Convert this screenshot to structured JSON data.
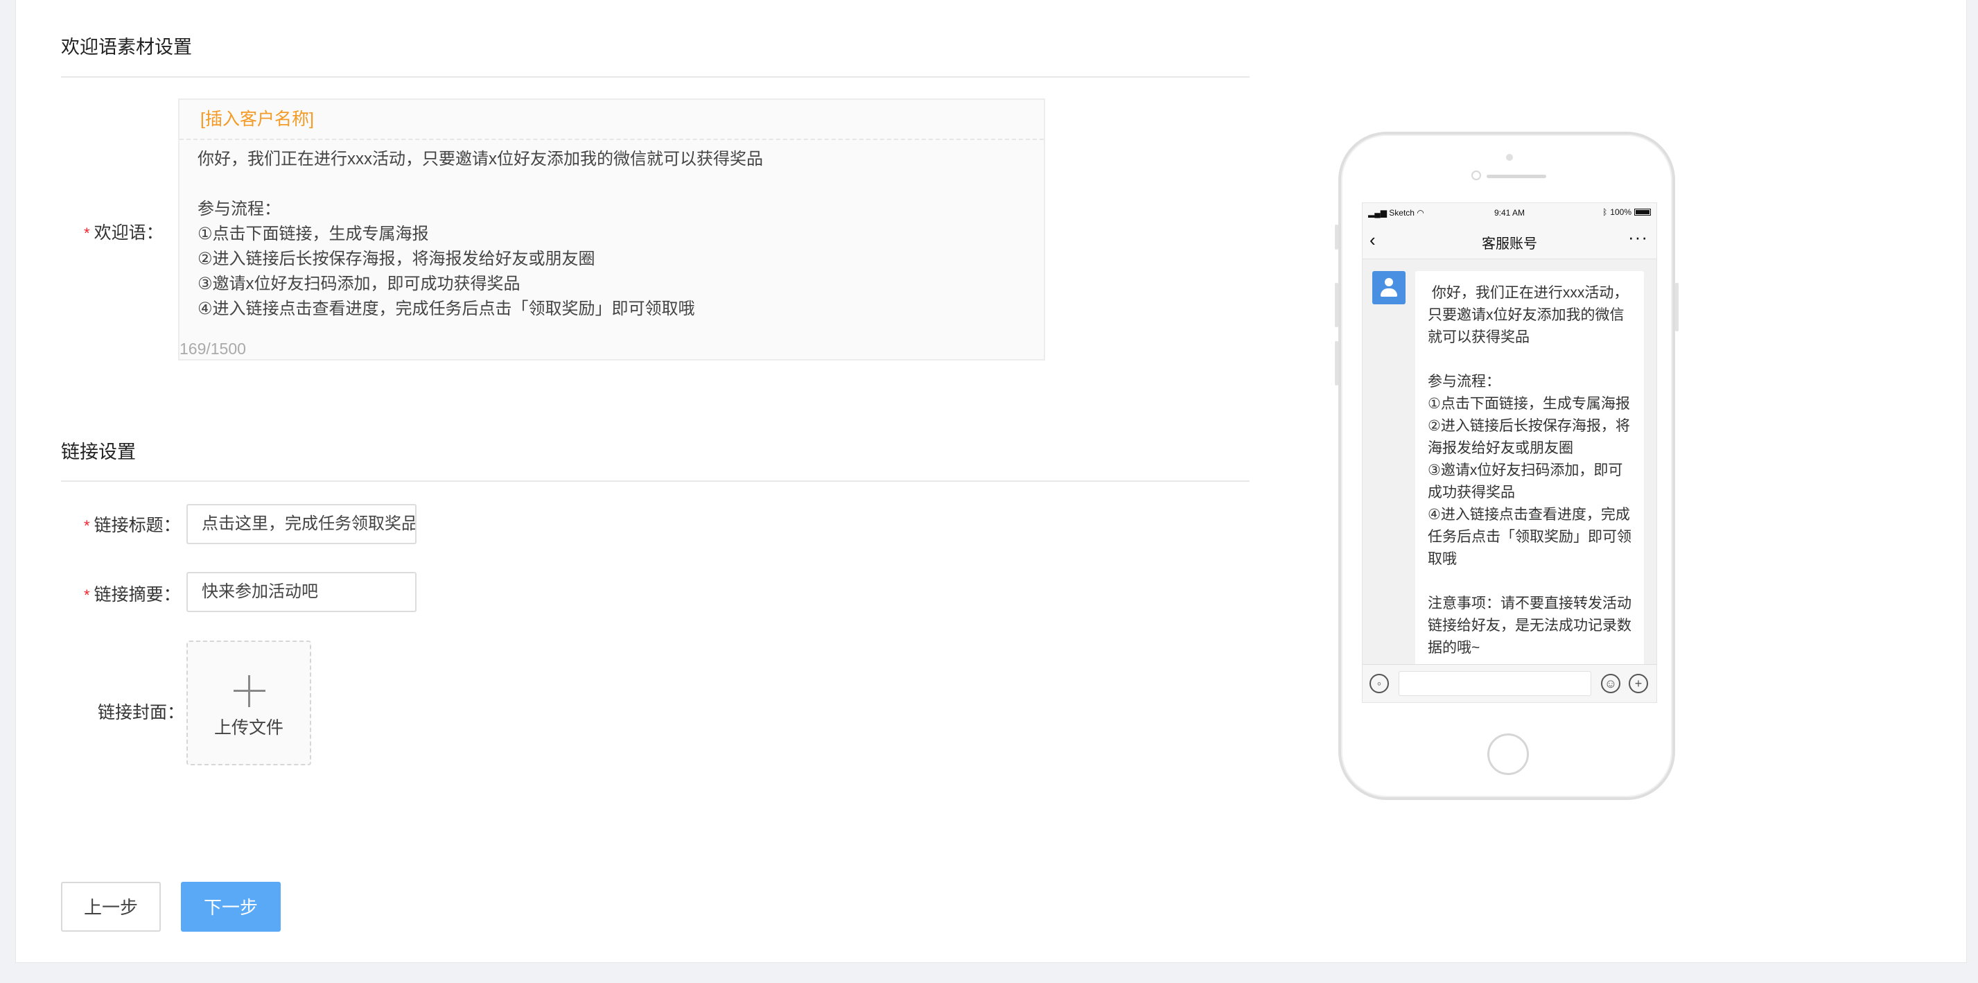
{
  "welcome_section": {
    "title": "欢迎语素材设置",
    "label": "欢迎语：",
    "insert_customer_name": "[插入客户名称]",
    "text": "你好，我们正在进行xxx活动，只要邀请x位好友添加我的微信就可以获得奖品\n\n参与流程：\n①点击下面链接，生成专属海报\n②进入链接后长按保存海报，将海报发给好友或朋友圈\n③邀请x位好友扫码添加，即可成功获得奖品\n④进入链接点击查看进度，完成任务后点击「领取奖励」即可领取哦",
    "char_count": "169/1500"
  },
  "link_section": {
    "title": "链接设置",
    "title_label": "链接标题：",
    "title_value": "点击这里，完成任务领取奖品吧",
    "summary_label": "链接摘要：",
    "summary_value": "快来参加活动吧",
    "cover_label": "链接封面：",
    "upload_label": "上传文件"
  },
  "buttons": {
    "prev": "上一步",
    "next": "下一步"
  },
  "phone_preview": {
    "status_carrier": "Sketch",
    "status_time": "9:41 AM",
    "status_battery": "100%",
    "nav_title": "客服账号",
    "back_glyph": "‹",
    "more_glyph": "···",
    "message": " 你好，我们正在进行xxx活动，只要邀请x位好友添加我的微信就可以获得奖品\n\n参与流程：\n①点击下面链接，生成专属海报\n②进入链接后长按保存海报，将海报发给好友或朋友圈\n③邀请x位好友扫码添加，即可成功获得奖品\n④进入链接点击查看进度，完成任务后点击「领取奖励」即可领取哦\n\n注意事项：请不要直接转发活动链接给好友，是无法成功记录数据的哦~"
  },
  "colors": {
    "accent": "#5aa9f7",
    "insert_link": "#f39b26",
    "required": "#f5222d",
    "avatar": "#4a90e2"
  }
}
